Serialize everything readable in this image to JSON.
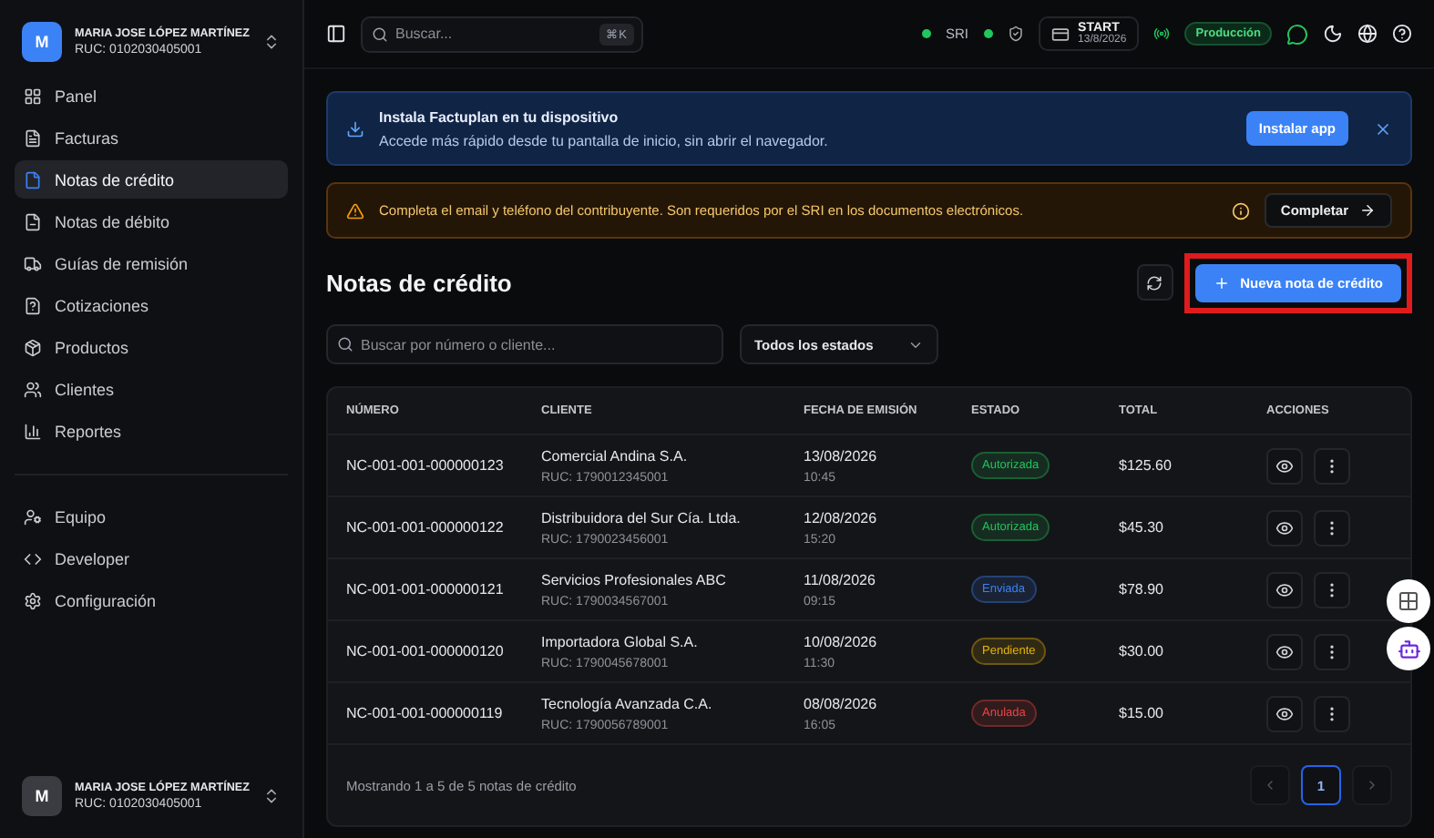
{
  "account": {
    "initial": "M",
    "name": "MARIA JOSE LÓPEZ MARTÍNEZ",
    "ruc": "RUC: 0102030405001"
  },
  "sidebar": {
    "groups": [
      [
        {
          "label": "Panel",
          "selected": false
        },
        {
          "label": "Facturas",
          "selected": false
        },
        {
          "label": "Notas de crédito",
          "selected": true
        },
        {
          "label": "Notas de débito",
          "selected": false
        },
        {
          "label": "Guías de remisión",
          "selected": false
        },
        {
          "label": "Cotizaciones",
          "selected": false
        },
        {
          "label": "Productos",
          "selected": false
        },
        {
          "label": "Clientes",
          "selected": false
        },
        {
          "label": "Reportes",
          "selected": false
        }
      ],
      [
        {
          "label": "Equipo",
          "selected": false
        },
        {
          "label": "Developer",
          "selected": false
        },
        {
          "label": "Configuración",
          "selected": false
        }
      ]
    ]
  },
  "footer_account": {
    "initial": "M",
    "name": "MARIA JOSE LÓPEZ MARTÍNEZ",
    "ruc": "RUC: 0102030405001"
  },
  "topbar": {
    "search_placeholder": "Buscar...",
    "shortcut": "⌘K",
    "sri_label": "SRI",
    "plan": "START",
    "plan_date": "13/8/2026",
    "environment": "Producción"
  },
  "install_banner": {
    "title": "Instala Factuplan en tu dispositivo",
    "text": "Accede más rápido desde tu pantalla de inicio, sin abrir el navegador.",
    "button": "Instalar app"
  },
  "warning": {
    "text": "Completa el email y teléfono del contribuyente. Son requeridos por el SRI en los documentos electrónicos.",
    "button": "Completar"
  },
  "page": {
    "title": "Notas de crédito",
    "new_button": "Nueva nota de crédito",
    "search_placeholder": "Buscar por número o cliente...",
    "status_filter": "Todos los estados"
  },
  "table": {
    "columns": [
      "NÚMERO",
      "CLIENTE",
      "FECHA DE EMISIÓN",
      "ESTADO",
      "TOTAL",
      "ACCIONES"
    ],
    "rows": [
      {
        "number": "NC-001-001-000000123",
        "client": "Comercial Andina S.A.",
        "ruc": "RUC: 1790012345001",
        "date": "13/08/2026",
        "time": "10:45",
        "status": "Autorizada",
        "color": "#22c55e",
        "total": "$125.60"
      },
      {
        "number": "NC-001-001-000000122",
        "client": "Distribuidora del Sur Cía. Ltda.",
        "ruc": "RUC: 1790023456001",
        "date": "12/08/2026",
        "time": "15:20",
        "status": "Autorizada",
        "color": "#22c55e",
        "total": "$45.30"
      },
      {
        "number": "NC-001-001-000000121",
        "client": "Servicios Profesionales ABC",
        "ruc": "RUC: 1790034567001",
        "date": "11/08/2026",
        "time": "09:15",
        "status": "Enviada",
        "color": "#3b82f6",
        "total": "$78.90"
      },
      {
        "number": "NC-001-001-000000120",
        "client": "Importadora Global S.A.",
        "ruc": "RUC: 1790045678001",
        "date": "10/08/2026",
        "time": "11:30",
        "status": "Pendiente",
        "color": "#eab308",
        "total": "$30.00"
      },
      {
        "number": "NC-001-001-000000119",
        "client": "Tecnología Avanzada C.A.",
        "ruc": "RUC: 1790056789001",
        "date": "08/08/2026",
        "time": "16:05",
        "status": "Anulada",
        "color": "#ef4444",
        "total": "$15.00"
      }
    ],
    "summary": "Mostrando 1 a 5 de 5 notas de crédito",
    "pages": [
      {
        "label": "1",
        "selected": true
      }
    ]
  }
}
